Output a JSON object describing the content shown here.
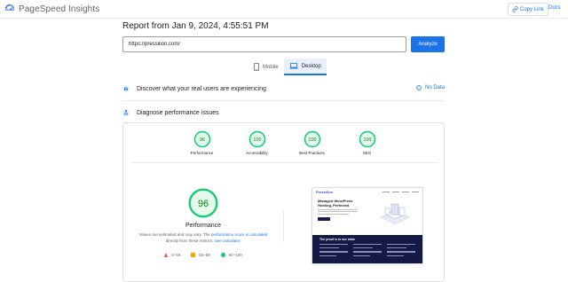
{
  "header": {
    "app_name": "PageSpeed Insights",
    "copy_link": "Copy Link",
    "docs": "Docs"
  },
  "report": {
    "title": "Report from Jan 9, 2024, 4:55:51 PM",
    "url_value": "https://pressilion.com/",
    "analyze_label": "Analyze"
  },
  "device_tabs": [
    {
      "label": "Mobile",
      "icon": "smartphone-icon",
      "active": false
    },
    {
      "label": "Desktop",
      "icon": "laptop-icon",
      "active": true
    }
  ],
  "sections": {
    "real_users": "Discover what your real users are experiencing",
    "no_data": "No Data",
    "diagnose": "Diagnose performance issues"
  },
  "scores": [
    {
      "label": "Performance",
      "value": "96"
    },
    {
      "label": "Accessibility",
      "value": "100"
    },
    {
      "label": "Best Practices",
      "value": "100"
    },
    {
      "label": "SEO",
      "value": "100"
    }
  ],
  "performance": {
    "score": "96",
    "title": "Performance",
    "note_prefix": "Values are estimated and may vary. The ",
    "note_link1": "performance score is calculated",
    "note_mid": " directly from these metrics. ",
    "note_link2": "See calculator."
  },
  "legend": [
    {
      "range": "0–49",
      "shape": "triangle",
      "color": "#ff4e42"
    },
    {
      "range": "50–89",
      "shape": "square",
      "color": "#ffa400"
    },
    {
      "range": "90–100",
      "shape": "circle",
      "color": "#0cce6b"
    }
  ],
  "preview": {
    "logo": "Pressilion",
    "headline": "Managed WordPress Hosting, Perfected",
    "dark_title": "The proof is in our stats"
  },
  "colors": {
    "accent": "#1a73e8",
    "pass": "#0cce6b",
    "pass_fill": "#e6f9ee",
    "pass_text": "#008800"
  }
}
